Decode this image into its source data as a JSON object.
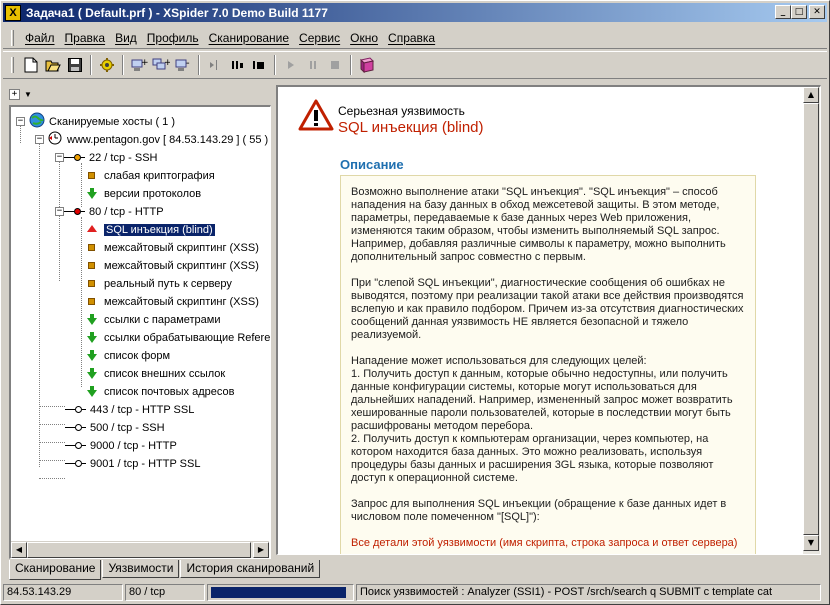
{
  "window": {
    "title": "Задача1 ( Default.prf ) - XSpider 7.0 Demo Build 1177",
    "app_icon": "X"
  },
  "menu": [
    "Файл",
    "Правка",
    "Вид",
    "Профиль",
    "Сканирование",
    "Сервис",
    "Окно",
    "Справка"
  ],
  "toolbar": [
    "new-icon",
    "open-icon",
    "save-icon",
    "scan-settings-icon",
    "add-host-icon",
    "add-hosts-icon",
    "remove-host-icon",
    "start-icon",
    "pause-icon",
    "stop-icon",
    "play-icon",
    "pause2-icon",
    "stop2-icon",
    "book-icon"
  ],
  "tree": {
    "root": "Сканируемые хосты ( 1 )",
    "host": "www.pentagon.gov [ 84.53.143.29 ] ( 55 )",
    "ports": [
      {
        "label": "22 / tcp - SSH",
        "items": [
          "слабая криптография",
          "версии протоколов"
        ]
      },
      {
        "label": "80 / tcp - HTTP",
        "items": [
          "SQL инъекция (blind)",
          "межсайтовый скриптинг (XSS)",
          "межсайтовый скриптинг (XSS)",
          "реальный путь к серверу",
          "межсайтовый скриптинг (XSS)",
          "ссылки с параметрами",
          "ссылки обрабатывающие Referer",
          "список форм",
          "список внешних ссылок",
          "список почтовых адресов"
        ]
      },
      {
        "label": "443 / tcp - HTTP SSL"
      },
      {
        "label": "500 / tcp - SSH"
      },
      {
        "label": "9000 / tcp - HTTP"
      },
      {
        "label": "9001 / tcp - HTTP SSL"
      }
    ]
  },
  "detail": {
    "severity": "Серьезная уязвимость",
    "title": "SQL инъекция (blind)",
    "section": "Описание",
    "paragraphs": [
      "Возможно выполнение атаки \"SQL инъекция\". \"SQL инъекция\" – способ нападения на базу данных в обход межсетевой защиты. В этом методе, параметры, передаваемые к базе данных через Web приложения, изменяются таким образом, чтобы изменить выполняемый SQL запрос. Например, добавляя различные символы к параметру, можно выполнить дополнительный запрос совместно с первым.",
      "При \"слепой SQL инъекции\", диагностические сообщения об ошибках не выводятся, поэтому при реализации такой атаки все действия производятся вслепую и как правило подбором. Причем из-за отсутствия диагностических сообщений данная уязвимость НЕ является безопасной и тяжело реализуемой.",
      "Нападение может использоваться для следующих целей:\n1. Получить доступ к данным, которые обычно недоступны, или получить данные конфигурации системы, которые могут использоваться для дальнейших нападений. Например, измененный запрос может возвратить хешированные пароли пользователей, которые в последствии могут быть расшифрованы методом перебора.\n2. Получить доступ к компьютерам организации, через компьютер, на котором находится база данных. Это можно реализовать, используя процедуры базы данных и расширения 3GL языка, которые позволяют доступ к операционной системе.",
      "Запрос для выполнения SQL инъекции (обращение к базе данных идет в числовом поле помеченном \"[SQL]\"):"
    ],
    "warning": "Все детали этой уязвимости (имя скрипта, строка запроса и ответ сервера)"
  },
  "tabs": [
    "Сканирование",
    "Уязвимости",
    "История сканирований"
  ],
  "status": {
    "ip": "84.53.143.29",
    "port": "80 / tcp",
    "progress": 0.97,
    "message": "Поиск уязвимостей : Analyzer (SSI1) - POST /srch/search q SUBMIT с template cat"
  },
  "colors": {
    "accent": "#0a246a",
    "severity_red": "#c02000",
    "section_blue": "#2070b0"
  }
}
